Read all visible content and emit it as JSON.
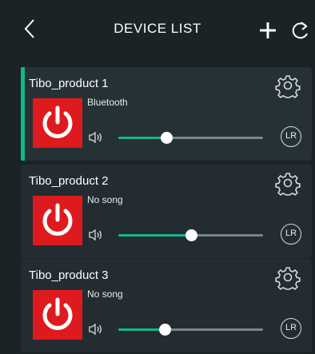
{
  "header": {
    "title": "DEVICE LIST",
    "back_icon": "chevron-left-icon",
    "add_icon": "plus-icon",
    "refresh_icon": "refresh-icon"
  },
  "colors": {
    "background": "#1b2327",
    "card": "#232d31",
    "accent": "#13b58f",
    "power": "#df1a1e"
  },
  "devices": [
    {
      "name": "Tibo_product 1",
      "status": "Bluetooth",
      "volume": 0.33,
      "selected": true,
      "lr_label": "LR"
    },
    {
      "name": "Tibo_product 2",
      "status": "No song",
      "volume": 0.5,
      "selected": false,
      "lr_label": "LR"
    },
    {
      "name": "Tibo_product 3",
      "status": "No song",
      "volume": 0.32,
      "selected": false,
      "lr_label": "LR"
    }
  ]
}
